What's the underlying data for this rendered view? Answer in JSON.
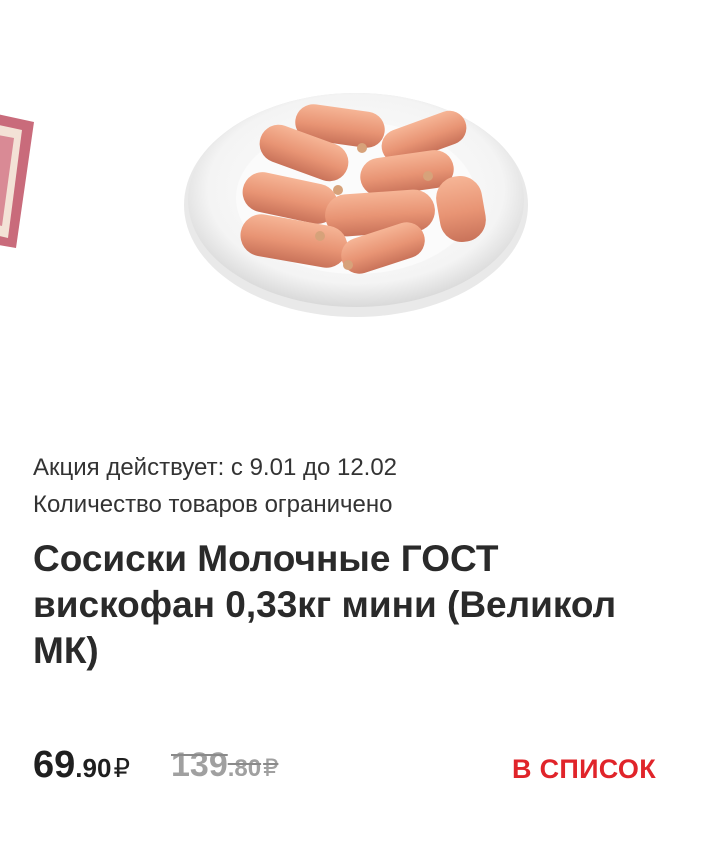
{
  "product": {
    "image_icon": "sausages-on-plate-image",
    "promo_period": "Акция действует: с 9.01 до 12.02",
    "limited_note": "Количество товаров ограничено",
    "title": "Сосиски Молочные ГОСТ вискофан 0,33кг мини (Великол МК)",
    "price": {
      "current_int": "69",
      "current_frac": ".90",
      "old_int": "139",
      "old_frac": ".80",
      "currency": "₽"
    },
    "add_to_list_label": "В СПИСОК"
  },
  "colors": {
    "accent": "#e0242a",
    "text": "#222222",
    "old_price": "#a0a0a0"
  }
}
